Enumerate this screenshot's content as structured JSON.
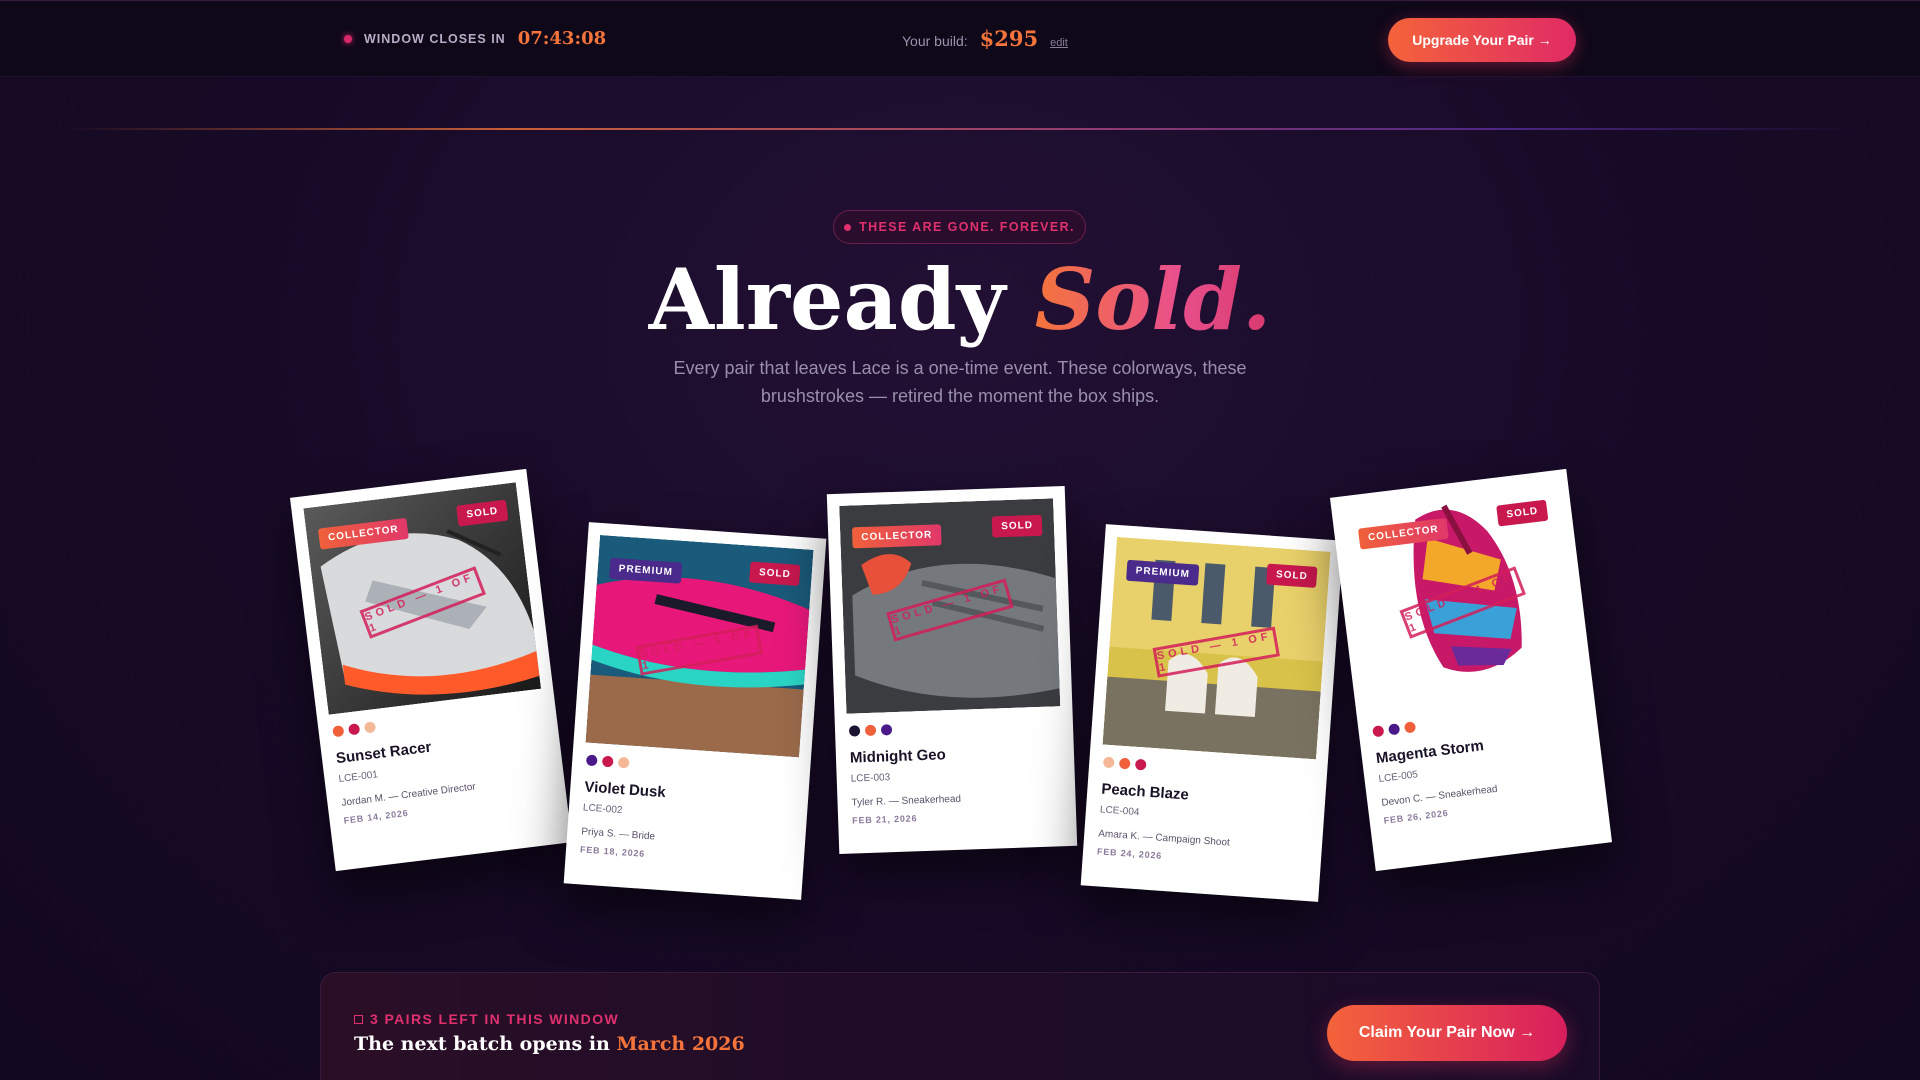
{
  "topbar": {
    "window_label": "WINDOW CLOSES IN",
    "timer": "07:43:08",
    "build_label": "Your build:",
    "build_price": "$295",
    "edit_label": "edit",
    "upgrade_label": "Upgrade Your Pair →"
  },
  "hero": {
    "pill": "THESE ARE GONE. FOREVER.",
    "title_plain": "Already ",
    "title_accent": "Sold.",
    "subtitle": "Every pair that leaves Lace is a one-time event. These colorways, these brushstrokes — retired the moment the box ships."
  },
  "cards": [
    {
      "tier": "COLLECTOR",
      "tier_style": "collector",
      "sold": "SOLD",
      "stamp": "SOLD — 1 OF 1",
      "swatches": [
        "#f0603a",
        "#c8184e",
        "#f4b896"
      ],
      "name": "Sunset Racer",
      "code": "LCE-001",
      "owner": "Jordan M. — Creative Director",
      "date": "FEB 14, 2026",
      "photo": "sunset"
    },
    {
      "tier": "PREMIUM",
      "tier_style": "premium",
      "sold": "SOLD",
      "stamp": "SOLD — 1 OF 1",
      "swatches": [
        "#4a1a8a",
        "#c8184e",
        "#f4b896"
      ],
      "name": "Violet Dusk",
      "code": "LCE-002",
      "owner": "Priya S. — Bride",
      "date": "FEB 18, 2026",
      "photo": "violet"
    },
    {
      "tier": "COLLECTOR",
      "tier_style": "collector",
      "sold": "SOLD",
      "stamp": "SOLD — 1 OF 1",
      "swatches": [
        "#1a1430",
        "#f0603a",
        "#4a1a8a"
      ],
      "name": "Midnight Geo",
      "code": "LCE-003",
      "owner": "Tyler R. — Sneakerhead",
      "date": "FEB 21, 2026",
      "photo": "midnight"
    },
    {
      "tier": "PREMIUM",
      "tier_style": "premium",
      "sold": "SOLD",
      "stamp": "SOLD — 1 OF 1",
      "swatches": [
        "#f4b896",
        "#f0603a",
        "#c8184e"
      ],
      "name": "Peach Blaze",
      "code": "LCE-004",
      "owner": "Amara K. — Campaign Shoot",
      "date": "FEB 24, 2026",
      "photo": "peach"
    },
    {
      "tier": "COLLECTOR",
      "tier_style": "collector",
      "sold": "SOLD",
      "stamp": "SOLD — 1 OF 1",
      "swatches": [
        "#c8184e",
        "#4a1a8a",
        "#f0603a"
      ],
      "name": "Magenta Storm",
      "code": "LCE-005",
      "owner": "Devon C. — Sneakerhead",
      "date": "FEB 26, 2026",
      "photo": "magenta"
    }
  ],
  "banner": {
    "label": "3 PAIRS LEFT IN THIS WINDOW",
    "title_plain": "The next batch opens in ",
    "title_accent": "March 2026",
    "cta": "Claim Your Pair Now →"
  }
}
